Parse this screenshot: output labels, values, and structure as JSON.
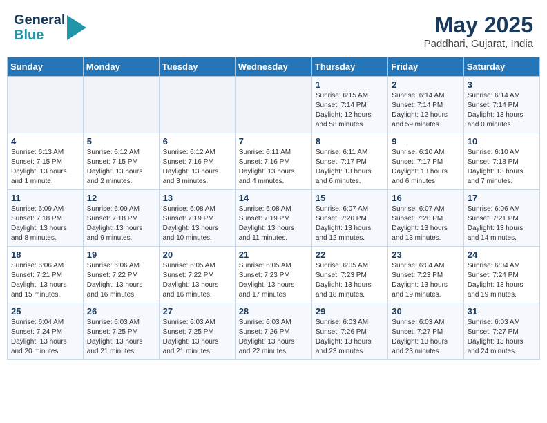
{
  "header": {
    "logo_line1": "General",
    "logo_line2": "Blue",
    "month_year": "May 2025",
    "location": "Paddhari, Gujarat, India"
  },
  "weekdays": [
    "Sunday",
    "Monday",
    "Tuesday",
    "Wednesday",
    "Thursday",
    "Friday",
    "Saturday"
  ],
  "weeks": [
    [
      {
        "day": "",
        "info": ""
      },
      {
        "day": "",
        "info": ""
      },
      {
        "day": "",
        "info": ""
      },
      {
        "day": "",
        "info": ""
      },
      {
        "day": "1",
        "info": "Sunrise: 6:15 AM\nSunset: 7:14 PM\nDaylight: 12 hours\nand 58 minutes."
      },
      {
        "day": "2",
        "info": "Sunrise: 6:14 AM\nSunset: 7:14 PM\nDaylight: 12 hours\nand 59 minutes."
      },
      {
        "day": "3",
        "info": "Sunrise: 6:14 AM\nSunset: 7:14 PM\nDaylight: 13 hours\nand 0 minutes."
      }
    ],
    [
      {
        "day": "4",
        "info": "Sunrise: 6:13 AM\nSunset: 7:15 PM\nDaylight: 13 hours\nand 1 minute."
      },
      {
        "day": "5",
        "info": "Sunrise: 6:12 AM\nSunset: 7:15 PM\nDaylight: 13 hours\nand 2 minutes."
      },
      {
        "day": "6",
        "info": "Sunrise: 6:12 AM\nSunset: 7:16 PM\nDaylight: 13 hours\nand 3 minutes."
      },
      {
        "day": "7",
        "info": "Sunrise: 6:11 AM\nSunset: 7:16 PM\nDaylight: 13 hours\nand 4 minutes."
      },
      {
        "day": "8",
        "info": "Sunrise: 6:11 AM\nSunset: 7:17 PM\nDaylight: 13 hours\nand 6 minutes."
      },
      {
        "day": "9",
        "info": "Sunrise: 6:10 AM\nSunset: 7:17 PM\nDaylight: 13 hours\nand 6 minutes."
      },
      {
        "day": "10",
        "info": "Sunrise: 6:10 AM\nSunset: 7:18 PM\nDaylight: 13 hours\nand 7 minutes."
      }
    ],
    [
      {
        "day": "11",
        "info": "Sunrise: 6:09 AM\nSunset: 7:18 PM\nDaylight: 13 hours\nand 8 minutes."
      },
      {
        "day": "12",
        "info": "Sunrise: 6:09 AM\nSunset: 7:18 PM\nDaylight: 13 hours\nand 9 minutes."
      },
      {
        "day": "13",
        "info": "Sunrise: 6:08 AM\nSunset: 7:19 PM\nDaylight: 13 hours\nand 10 minutes."
      },
      {
        "day": "14",
        "info": "Sunrise: 6:08 AM\nSunset: 7:19 PM\nDaylight: 13 hours\nand 11 minutes."
      },
      {
        "day": "15",
        "info": "Sunrise: 6:07 AM\nSunset: 7:20 PM\nDaylight: 13 hours\nand 12 minutes."
      },
      {
        "day": "16",
        "info": "Sunrise: 6:07 AM\nSunset: 7:20 PM\nDaylight: 13 hours\nand 13 minutes."
      },
      {
        "day": "17",
        "info": "Sunrise: 6:06 AM\nSunset: 7:21 PM\nDaylight: 13 hours\nand 14 minutes."
      }
    ],
    [
      {
        "day": "18",
        "info": "Sunrise: 6:06 AM\nSunset: 7:21 PM\nDaylight: 13 hours\nand 15 minutes."
      },
      {
        "day": "19",
        "info": "Sunrise: 6:06 AM\nSunset: 7:22 PM\nDaylight: 13 hours\nand 16 minutes."
      },
      {
        "day": "20",
        "info": "Sunrise: 6:05 AM\nSunset: 7:22 PM\nDaylight: 13 hours\nand 16 minutes."
      },
      {
        "day": "21",
        "info": "Sunrise: 6:05 AM\nSunset: 7:23 PM\nDaylight: 13 hours\nand 17 minutes."
      },
      {
        "day": "22",
        "info": "Sunrise: 6:05 AM\nSunset: 7:23 PM\nDaylight: 13 hours\nand 18 minutes."
      },
      {
        "day": "23",
        "info": "Sunrise: 6:04 AM\nSunset: 7:23 PM\nDaylight: 13 hours\nand 19 minutes."
      },
      {
        "day": "24",
        "info": "Sunrise: 6:04 AM\nSunset: 7:24 PM\nDaylight: 13 hours\nand 19 minutes."
      }
    ],
    [
      {
        "day": "25",
        "info": "Sunrise: 6:04 AM\nSunset: 7:24 PM\nDaylight: 13 hours\nand 20 minutes."
      },
      {
        "day": "26",
        "info": "Sunrise: 6:03 AM\nSunset: 7:25 PM\nDaylight: 13 hours\nand 21 minutes."
      },
      {
        "day": "27",
        "info": "Sunrise: 6:03 AM\nSunset: 7:25 PM\nDaylight: 13 hours\nand 21 minutes."
      },
      {
        "day": "28",
        "info": "Sunrise: 6:03 AM\nSunset: 7:26 PM\nDaylight: 13 hours\nand 22 minutes."
      },
      {
        "day": "29",
        "info": "Sunrise: 6:03 AM\nSunset: 7:26 PM\nDaylight: 13 hours\nand 23 minutes."
      },
      {
        "day": "30",
        "info": "Sunrise: 6:03 AM\nSunset: 7:27 PM\nDaylight: 13 hours\nand 23 minutes."
      },
      {
        "day": "31",
        "info": "Sunrise: 6:03 AM\nSunset: 7:27 PM\nDaylight: 13 hours\nand 24 minutes."
      }
    ]
  ]
}
